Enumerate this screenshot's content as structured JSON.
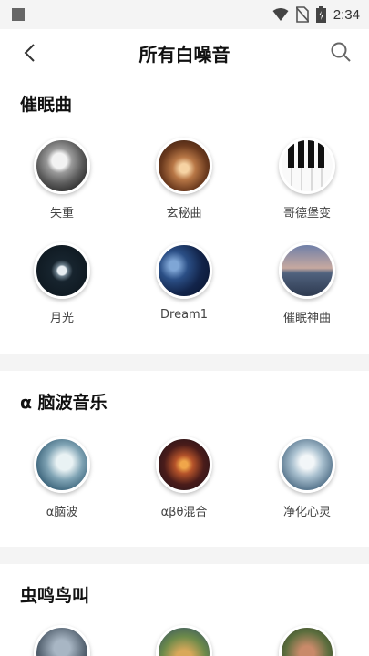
{
  "status_bar": {
    "time": "2:34"
  },
  "header": {
    "title": "所有白噪音"
  },
  "sections": [
    {
      "title": "催眠曲",
      "items": [
        {
          "label": "失重"
        },
        {
          "label": "玄秘曲"
        },
        {
          "label": "哥德堡变"
        },
        {
          "label": "月光"
        },
        {
          "label": "Dream1"
        },
        {
          "label": "催眠神曲"
        }
      ]
    },
    {
      "title": "α 脑波音乐",
      "items": [
        {
          "label": "α脑波"
        },
        {
          "label": "αβθ混合"
        },
        {
          "label": "净化心灵"
        }
      ]
    },
    {
      "title": "虫鸣鸟叫",
      "items": []
    }
  ]
}
